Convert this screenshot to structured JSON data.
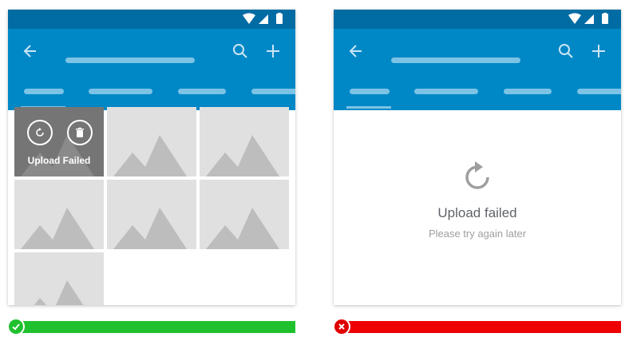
{
  "left_example": {
    "failed_tile_label": "Upload Failed",
    "icons": [
      "retry-icon",
      "delete-icon",
      "image-placeholder-icon"
    ],
    "verdict_icon": "check-icon"
  },
  "right_example": {
    "empty_state_title": "Upload failed",
    "empty_state_subtitle": "Please try again later",
    "verdict_icon": "close-icon"
  },
  "colors": {
    "status_bar": "#006ca3",
    "app_bar": "#0088c6",
    "do_green": "#1fc12e",
    "dont_red": "#ee0000"
  }
}
